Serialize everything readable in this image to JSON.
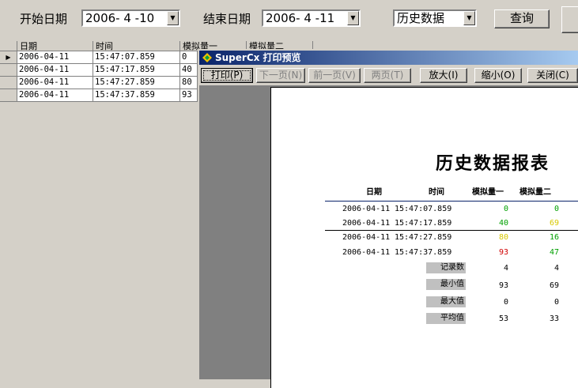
{
  "filter": {
    "start_label": "开始日期",
    "start_value": "2006- 4 -10",
    "end_label": "结束日期",
    "end_value": "2006- 4 -11",
    "type_value": "历史数据",
    "query_label": "查询"
  },
  "grid": {
    "headers": [
      "日期",
      "时间",
      "模拟量一",
      "模拟量二"
    ],
    "rows": [
      {
        "date": "2006-04-11",
        "time": "15:47:07.859",
        "v1": "0"
      },
      {
        "date": "2006-04-11",
        "time": "15:47:17.859",
        "v1": "40"
      },
      {
        "date": "2006-04-11",
        "time": "15:47:27.859",
        "v1": "80"
      },
      {
        "date": "2006-04-11",
        "time": "15:47:37.859",
        "v1": "93"
      }
    ],
    "current_row_marker": "▶"
  },
  "preview": {
    "title": "SuperCx 打印预览",
    "toolbar": {
      "print": "打印(P)",
      "next": "下一页(N)",
      "prev": "前一页(V)",
      "two": "两页(T)",
      "zoomin": "放大(I)",
      "zoomout": "缩小(O)",
      "close": "关闭(C)"
    },
    "report": {
      "title": "历史数据报表",
      "headers": {
        "date": "日期",
        "time": "时间",
        "v1": "模拟量一",
        "v2": "模拟量二"
      },
      "rows": [
        {
          "date": "2006-04-11",
          "time": "15:47:07.859",
          "v1": "0",
          "v2": "0"
        },
        {
          "date": "2006-04-11",
          "time": "15:47:17.859",
          "v1": "40",
          "v2": "69"
        },
        {
          "date": "2006-04-11",
          "time": "15:47:27.859",
          "v1": "80",
          "v2": "16"
        },
        {
          "date": "2006-04-11",
          "time": "15:47:37.859",
          "v1": "93",
          "v2": "47"
        }
      ],
      "summary": [
        {
          "label": "记录数",
          "v1": "4",
          "v2": "4"
        },
        {
          "label": "最小值",
          "v1": "93",
          "v2": "69"
        },
        {
          "label": "最大值",
          "v1": "0",
          "v2": "0"
        },
        {
          "label": "平均值",
          "v1": "53",
          "v2": "33"
        }
      ]
    }
  },
  "colors": {
    "green": "#00a000",
    "yellow": "#d8c800",
    "red": "#d00000",
    "titlebar": "#0a246a"
  }
}
